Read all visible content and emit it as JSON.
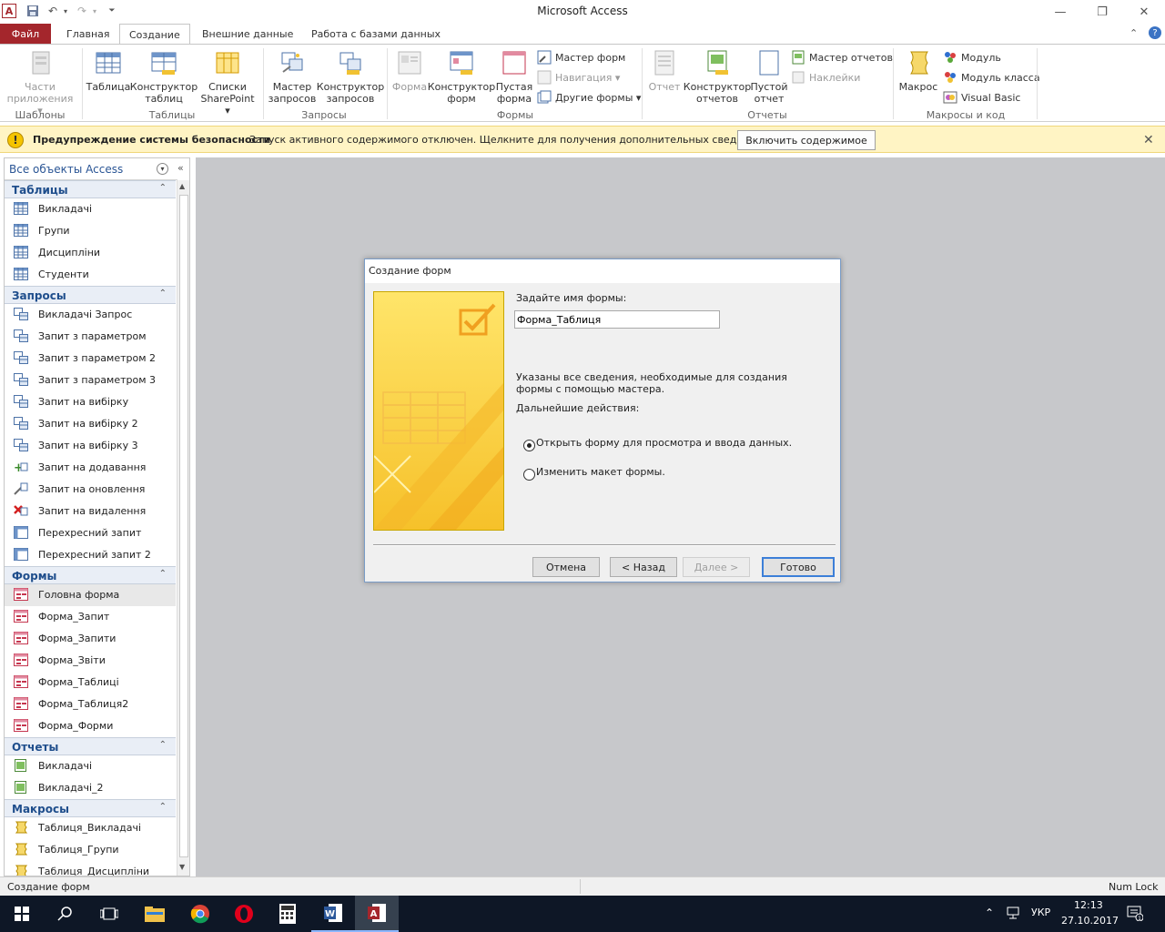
{
  "window": {
    "title": "Microsoft Access"
  },
  "ribbon_tabs": [
    {
      "label": "Файл"
    },
    {
      "label": "Главная"
    },
    {
      "label": "Создание"
    },
    {
      "label": "Внешние данные"
    },
    {
      "label": "Работа с базами данных"
    }
  ],
  "ribbon": {
    "templates": {
      "parts": "Части\nприложения ▾",
      "group": "Шаблоны"
    },
    "tables": {
      "table": "Таблица",
      "designer": "Конструктор\nтаблиц",
      "sharepoint": "Списки\nSharePoint ▾",
      "group": "Таблицы"
    },
    "queries": {
      "wizard": "Мастер\nзапросов",
      "designer": "Конструктор\nзапросов",
      "group": "Запросы"
    },
    "forms": {
      "form": "Форма",
      "designer": "Конструктор\nформ",
      "blank": "Пустая\nформа",
      "wizard": "Мастер форм",
      "navigation": "Навигация ▾",
      "other": "Другие формы ▾",
      "group": "Формы"
    },
    "reports": {
      "report": "Отчет",
      "designer": "Конструктор\nотчетов",
      "blank": "Пустой\nотчет",
      "wizard": "Мастер отчетов",
      "labels": "Наклейки",
      "group": "Отчеты"
    },
    "macros": {
      "macro": "Макрос",
      "module": "Модуль",
      "class_module": "Модуль класса",
      "vb": "Visual Basic",
      "group": "Макросы и код"
    }
  },
  "security_bar": {
    "title": "Предупреждение системы безопасности",
    "message": "Запуск активного содержимого отключен. Щелкните для получения дополнительных сведений.",
    "button": "Включить содержимое"
  },
  "nav": {
    "header": "Все объекты Access",
    "sections": [
      {
        "title": "Таблицы",
        "type": "table",
        "items": [
          "Викладачі",
          "Групи",
          "Дисципліни",
          "Студенти"
        ]
      },
      {
        "title": "Запросы",
        "type": "query",
        "items": [
          "Викладачі Запрос",
          "Запит з параметром",
          "Запит з параметром 2",
          "Запит з параметром 3",
          "Запит на вибірку",
          "Запит на вибірку 2",
          "Запит на вибірку 3",
          "Запит на додавання",
          "Запит на оновлення",
          "Запит на видалення",
          "Перехресний запит",
          "Перехресний запит 2"
        ]
      },
      {
        "title": "Формы",
        "type": "form",
        "items": [
          "Головна форма",
          "Форма_Запит",
          "Форма_Запити",
          "Форма_Звіти",
          "Форма_Таблиці",
          "Форма_Таблиця2",
          "Форма_Форми"
        ]
      },
      {
        "title": "Отчеты",
        "type": "report",
        "items": [
          "Викладачі",
          "Викладачі_2"
        ]
      },
      {
        "title": "Макросы",
        "type": "macro",
        "items": [
          "Таблиця_Викладачі",
          "Таблиця_Групи",
          "Таблиця_Дисципліни"
        ]
      }
    ]
  },
  "dialog": {
    "title": "Создание форм",
    "name_label": "Задайте имя формы:",
    "name_value": "Форма_Таблиця",
    "info": "Указаны все сведения, необходимые для создания формы с помощью мастера.",
    "next_label": "Дальнейшие действия:",
    "option_open": "Открыть форму для просмотра и ввода данных.",
    "option_edit": "Изменить макет формы.",
    "selected_option": "open",
    "buttons": {
      "cancel": "Отмена",
      "back": "< Назад",
      "next": "Далее >",
      "finish": "Готово"
    }
  },
  "status_bar": {
    "left": "Создание форм",
    "right": "Num Lock"
  },
  "taskbar": {
    "lang": "УКР",
    "time": "12:13",
    "date": "27.10.2017"
  },
  "colors": {
    "file_tab": "#a4262c",
    "security_bar": "#fff4c4",
    "workspace": "#c7c8cb",
    "taskbar": "#0e1726"
  }
}
